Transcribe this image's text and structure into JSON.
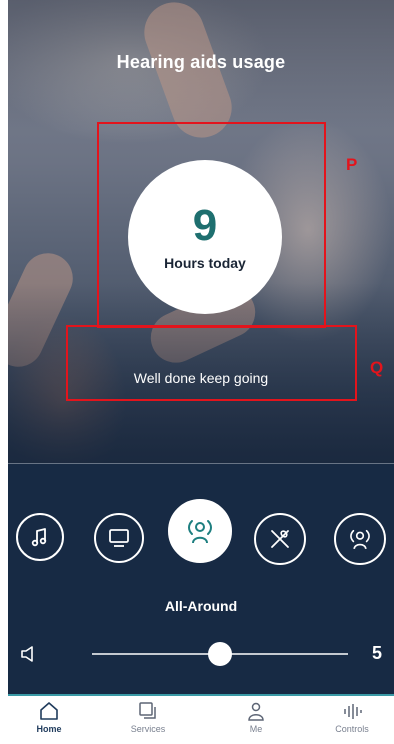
{
  "header": {
    "title": "Hearing aids usage"
  },
  "usage": {
    "hours": "9",
    "label": "Hours today",
    "message": "Well done keep going"
  },
  "annotations": {
    "box_p": "P",
    "box_q": "Q"
  },
  "programs": {
    "items": [
      {
        "name": "Music",
        "icon": "music-note-icon"
      },
      {
        "name": "TV",
        "icon": "tv-icon"
      },
      {
        "name": "All-Around",
        "icon": "person-sound-icon",
        "active": true
      },
      {
        "name": "Restaurant",
        "icon": "cutlery-icon"
      },
      {
        "name": "Speech",
        "icon": "person-sound-icon"
      }
    ],
    "selected_label": "All-Around"
  },
  "volume": {
    "value": "5",
    "level_fraction": 0.5
  },
  "nav": {
    "items": [
      {
        "label": "Home",
        "icon": "home-icon",
        "active": true
      },
      {
        "label": "Services",
        "icon": "services-icon"
      },
      {
        "label": "Me",
        "icon": "person-icon"
      },
      {
        "label": "Controls",
        "icon": "equalizer-icon"
      }
    ]
  },
  "colors": {
    "accent": "#1e6f6f",
    "panel": "#172a44",
    "annotation": "#e3141c",
    "nav_active": "#1f3b5c"
  }
}
